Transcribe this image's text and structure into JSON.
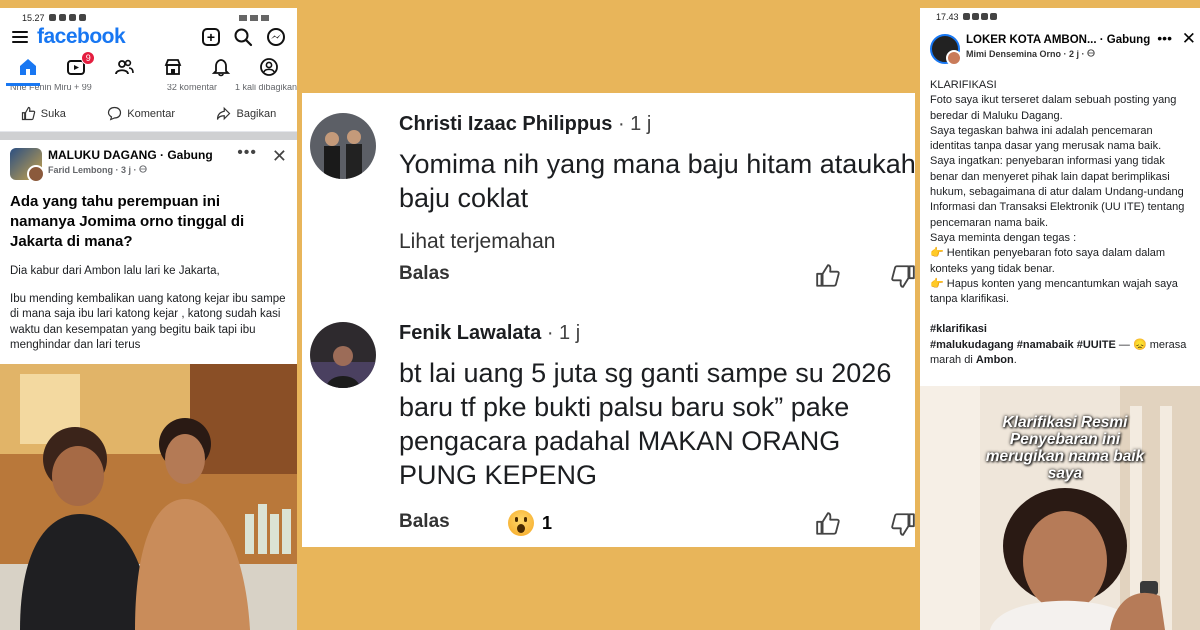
{
  "left": {
    "status_time": "15.27",
    "brand": "facebook",
    "nav_badge": "9",
    "reactions_line": "Nhe Fenin Miru + 99",
    "comments_count": "32 komentar",
    "shares_count": "1 kali dibagikan",
    "actions": {
      "like": "Suka",
      "comment": "Komentar",
      "share": "Bagikan"
    },
    "post": {
      "group_name": "MALUKU DAGANG",
      "join_label": "Gabung",
      "author": "Farid Lembong",
      "time": "3 j",
      "title": "Ada yang tahu perempuan ini namanya Jomima orno tinggal di Jakarta di mana?",
      "para1": "Dia kabur dari Ambon lalu lari ke Jakarta,",
      "para2": "Ibu mending kembalikan uang katong kejar ibu sampe di mana saja ibu lari katong kejar , katong sudah kasi waktu dan kesempatan yang begitu baik tapi ibu menghindar dan lari terus"
    }
  },
  "middle": {
    "comments": [
      {
        "name": "Christi Izaac Philippus",
        "time": "· 1 j",
        "text": "Yomima nih yang mana baju hitam ataukah baju coklat",
        "translate": "Lihat terjemahan",
        "reply": "Balas"
      },
      {
        "name": "Fenik Lawalata",
        "time": "· 1 j",
        "text": "bt lai uang 5 juta sg ganti sampe su 2026 baru tf pke bukti palsu baru sok” pake pengacara padahal MAKAN ORANG PUNG KEPENG",
        "reply": "Balas",
        "reaction_count": "1"
      }
    ]
  },
  "right": {
    "status_time": "17.43",
    "page_name": "LOKER KOTA AMBON...",
    "join_label": "· Gabung",
    "author": "Mimi Densemina Orno",
    "time": "· 2 j ·",
    "lines": {
      "l1": "KLARIFIKASI",
      "l2": "Foto saya ikut terseret dalam sebuah posting yang beredar di Maluku Dagang.",
      "l3": "Saya tegaskan bahwa ini adalah pencemaran identitas tanpa dasar yang merusak nama baik.",
      "l4": "Saya ingatkan: penyebaran informasi yang tidak benar dan menyeret pihak lain dapat berimplikasi hukum, sebagaimana di atur dalam Undang-undang Informasi dan Transaksi Elektronik (UU ITE) tentang pencemaran nama baik.",
      "l5": "Saya meminta dengan tegas :",
      "l6": "👉 Hentikan penyebaran foto saya dalam dalam konteks yang tidak benar.",
      "l7": "👉 Hapus konten yang mencantumkan wajah saya tanpa klarifikasi.",
      "tag1": "#klarifikasi",
      "tag2": "#malukudagang  #namabaik #UUITE",
      "feeling": " — 😞 merasa marah di ",
      "place": "Ambon",
      "period": "."
    },
    "overlay": "Klarifikasi Resmi Penyebaran ini merugikan nama baik saya"
  },
  "colors": {
    "brand_blue": "#1877f2",
    "background": "#e8b55a"
  }
}
